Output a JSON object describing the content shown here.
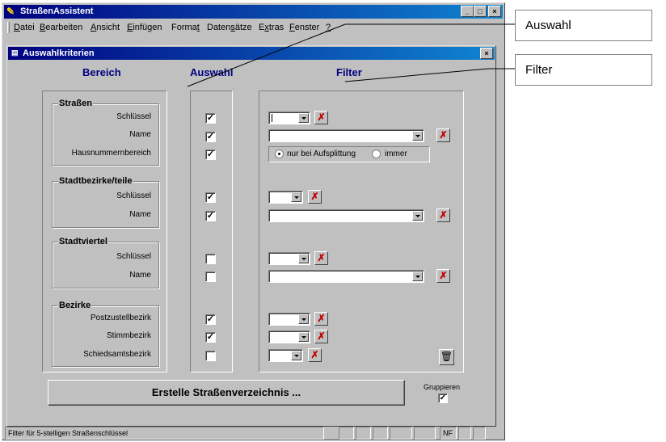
{
  "window": {
    "title": "StraßenAssistent",
    "icon": "wrench-icon"
  },
  "caption_buttons": [
    "_",
    "□",
    "×"
  ],
  "menu": [
    {
      "label": "Datei",
      "u": "D",
      "rest": "atei"
    },
    {
      "label": "Bearbeiten",
      "u": "B",
      "rest": "earbeiten"
    },
    {
      "label": "Ansicht",
      "u": "A",
      "rest": "nsicht"
    },
    {
      "label": "Einfügen",
      "u": "E",
      "rest": "infügen"
    },
    {
      "label": "Format",
      "pre": "Forma",
      "u": "t",
      "rest": ""
    },
    {
      "label": "Datensätze",
      "pre": "Daten",
      "u": "s",
      "rest": "ätze"
    },
    {
      "label": "Extras",
      "pre": "E",
      "u": "x",
      "rest": "tras"
    },
    {
      "label": "Fenster",
      "u": "F",
      "rest": "enster"
    },
    {
      "label": "?",
      "u": "?",
      "rest": ""
    }
  ],
  "child": {
    "title": "Auswahlkriterien",
    "close": "×"
  },
  "headers": {
    "bereich": "Bereich",
    "auswahl": "Auswahl",
    "filter": "Filter"
  },
  "groups": {
    "strassen": {
      "label": "Straßen",
      "fields": [
        "Schlüssel",
        "Name",
        "Hausnummernbereich"
      ],
      "checked": [
        true,
        true,
        true
      ]
    },
    "stadtbezirke": {
      "label": "Stadtbezirke/teile",
      "fields": [
        "Schlüssel",
        "Name"
      ],
      "checked": [
        true,
        true
      ]
    },
    "stadtviertel": {
      "label": "Stadtviertel",
      "fields": [
        "Schlüssel",
        "Name"
      ],
      "checked": [
        false,
        false
      ]
    },
    "bezirke": {
      "label": "Bezirke",
      "fields": [
        "Postzustellbezirk",
        "Stimmbezirk",
        "Schiedsamtsbezirk"
      ],
      "checked": [
        true,
        true,
        false
      ]
    }
  },
  "radio": {
    "option1": "nur bei Aufsplittung",
    "option2": "immer",
    "selected": "nur bei Aufsplittung"
  },
  "create_button": "Erstelle Straßenverzeichnis ...",
  "gruppieren": {
    "label": "Gruppieren",
    "checked": true
  },
  "status": {
    "text": "Filter für 5-stelligen Straßenschlüssel",
    "nf": "NF"
  },
  "callouts": {
    "auswahl": "Auswahl",
    "filter": "Filter"
  },
  "check_mark": "✓",
  "filter_clear_glyph": "✗",
  "trash_icon": "🗑"
}
